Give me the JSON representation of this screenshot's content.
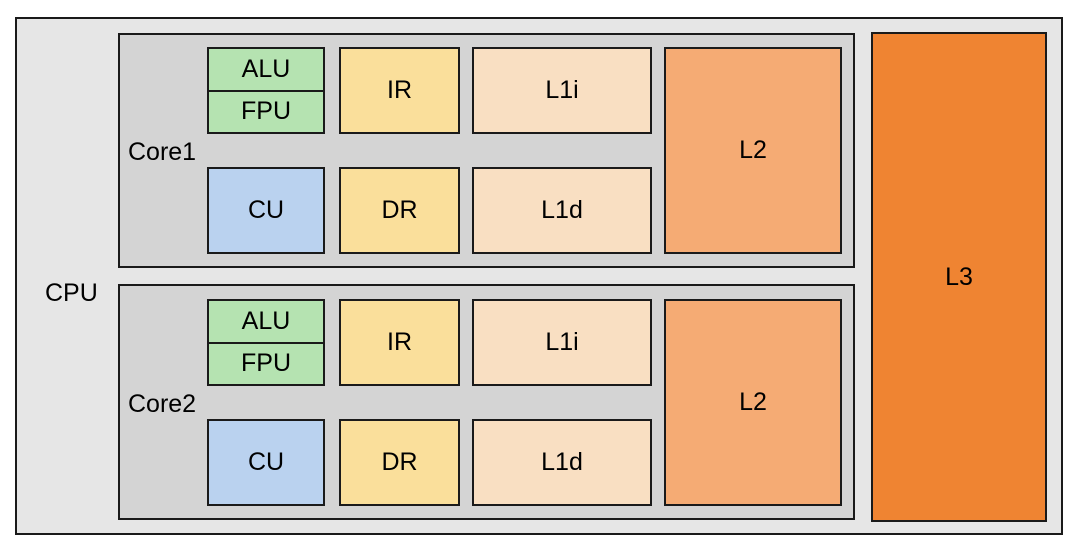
{
  "diagram": {
    "title": "CPU",
    "cpu": {
      "label": "CPU",
      "background": "#e6e6e6",
      "border_color": "#1a1a1a"
    },
    "cores": [
      {
        "label": "Core1",
        "background": "#d4d4d4",
        "units": {
          "alu": "ALU",
          "fpu": "FPU",
          "cu": "CU",
          "ir": "IR",
          "dr": "DR",
          "l1i": "L1i",
          "l1d": "L1d",
          "l2": "L2"
        }
      },
      {
        "label": "Core2",
        "background": "#d4d4d4",
        "units": {
          "alu": "ALU",
          "fpu": "FPU",
          "cu": "CU",
          "ir": "IR",
          "dr": "DR",
          "l1i": "L1i",
          "l1d": "L1d",
          "l2": "L2"
        }
      }
    ],
    "shared": {
      "l3": "L3"
    },
    "colors": {
      "page_background": "#ffffff",
      "cpu_fill": "#e6e6e6",
      "core_fill": "#d4d4d4",
      "execution_unit_fill": "#b5e3b1",
      "control_unit_fill": "#bad2ef",
      "register_fill": "#fadf9b",
      "l1_cache_fill": "#f9dfc2",
      "l2_cache_fill": "#f5ab74",
      "l3_cache_fill": "#ef8432",
      "stroke": "#1a1a1a",
      "text": "#000000"
    }
  }
}
